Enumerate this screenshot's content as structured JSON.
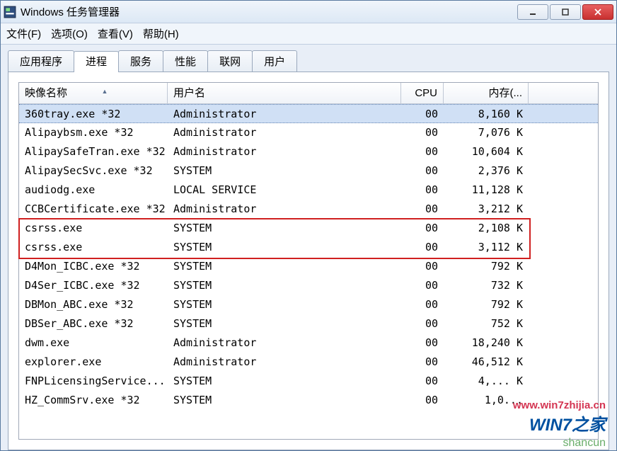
{
  "titlebar": {
    "title": "Windows 任务管理器"
  },
  "menubar": {
    "file": "文件(F)",
    "options": "选项(O)",
    "view": "查看(V)",
    "help": "帮助(H)"
  },
  "tabs": {
    "apps": "应用程序",
    "processes": "进程",
    "services": "服务",
    "performance": "性能",
    "network": "联网",
    "users": "用户"
  },
  "columns": {
    "name": "映像名称",
    "user": "用户名",
    "cpu": "CPU",
    "mem": "内存(..."
  },
  "processes": [
    {
      "name": "360tray.exe *32",
      "user": "Administrator",
      "cpu": "00",
      "mem": "8,160 K",
      "selected": true
    },
    {
      "name": "Alipaybsm.exe *32",
      "user": "Administrator",
      "cpu": "00",
      "mem": "7,076 K"
    },
    {
      "name": "AlipaySafeTran.exe *32",
      "user": "Administrator",
      "cpu": "00",
      "mem": "10,604 K"
    },
    {
      "name": "AlipaySecSvc.exe *32",
      "user": "SYSTEM",
      "cpu": "00",
      "mem": "2,376 K"
    },
    {
      "name": "audiodg.exe",
      "user": "LOCAL SERVICE",
      "cpu": "00",
      "mem": "11,128 K"
    },
    {
      "name": "CCBCertificate.exe *32",
      "user": "Administrator",
      "cpu": "00",
      "mem": "3,212 K"
    },
    {
      "name": "csrss.exe",
      "user": "SYSTEM",
      "cpu": "00",
      "mem": "2,108 K",
      "highlighted": true
    },
    {
      "name": "csrss.exe",
      "user": "SYSTEM",
      "cpu": "00",
      "mem": "3,112 K",
      "highlighted": true
    },
    {
      "name": "D4Mon_ICBC.exe *32",
      "user": "SYSTEM",
      "cpu": "00",
      "mem": "792 K"
    },
    {
      "name": "D4Ser_ICBC.exe *32",
      "user": "SYSTEM",
      "cpu": "00",
      "mem": "732 K"
    },
    {
      "name": "DBMon_ABC.exe *32",
      "user": "SYSTEM",
      "cpu": "00",
      "mem": "792 K"
    },
    {
      "name": "DBSer_ABC.exe *32",
      "user": "SYSTEM",
      "cpu": "00",
      "mem": "752 K"
    },
    {
      "name": "dwm.exe",
      "user": "Administrator",
      "cpu": "00",
      "mem": "18,240 K"
    },
    {
      "name": "explorer.exe",
      "user": "Administrator",
      "cpu": "00",
      "mem": "46,512 K"
    },
    {
      "name": "FNPLicensingService...",
      "user": "SYSTEM",
      "cpu": "00",
      "mem": "4,... K"
    },
    {
      "name": "HZ_CommSrv.exe *32",
      "user": "SYSTEM",
      "cpu": "00",
      "mem": "1,0..."
    }
  ],
  "watermarks": {
    "w1": "www.win7zhijia.cn",
    "w2": "WIN7之家",
    "w3": "shancun"
  }
}
